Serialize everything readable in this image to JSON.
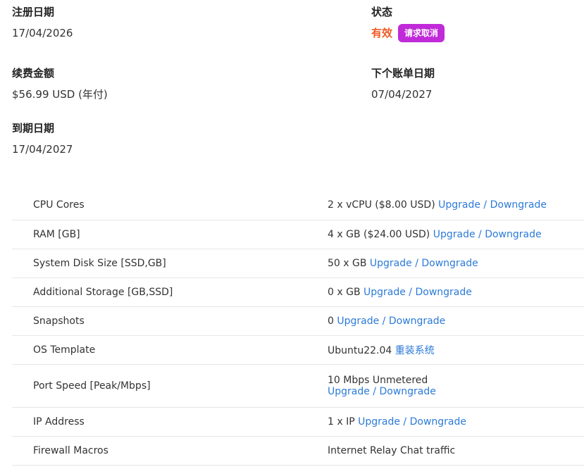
{
  "fields": {
    "registration": {
      "label": "注册日期",
      "value": "17/04/2026"
    },
    "status": {
      "label": "状态",
      "value": "有效",
      "cancel_button": "请求取消"
    },
    "renewal": {
      "label": "续费金额",
      "value": "$56.99 USD (年付)"
    },
    "next_due": {
      "label": "下个账单日期",
      "value": "07/04/2027"
    },
    "expiry": {
      "label": "到期日期",
      "value": "17/04/2027"
    }
  },
  "options": [
    {
      "name": "CPU Cores",
      "value": "2 x vCPU ($8.00 USD)",
      "link": "Upgrade / Downgrade"
    },
    {
      "name": "RAM [GB]",
      "value": "4 x GB ($24.00 USD)",
      "link": "Upgrade / Downgrade"
    },
    {
      "name": "System Disk Size [SSD,GB]",
      "value": "50 x GB",
      "link": "Upgrade / Downgrade"
    },
    {
      "name": "Additional Storage [GB,SSD]",
      "value": "0 x GB",
      "link": "Upgrade / Downgrade"
    },
    {
      "name": "Snapshots",
      "value": "0",
      "link": "Upgrade / Downgrade"
    },
    {
      "name": "OS Template",
      "value": "Ubuntu22.04",
      "link": "重装系统"
    },
    {
      "name": "Port Speed [Peak/Mbps]",
      "value": "10 Mbps Unmetered",
      "link": "Upgrade / Downgrade"
    },
    {
      "name": "IP Address",
      "value": "1 x IP",
      "link": "Upgrade / Downgrade"
    },
    {
      "name": "Firewall Macros",
      "value": "Internet Relay Chat traffic",
      "link": ""
    }
  ],
  "colors": {
    "status_active": "#f05a24",
    "cancel_button": "#c02ad8",
    "link": "#2b7ad8"
  }
}
